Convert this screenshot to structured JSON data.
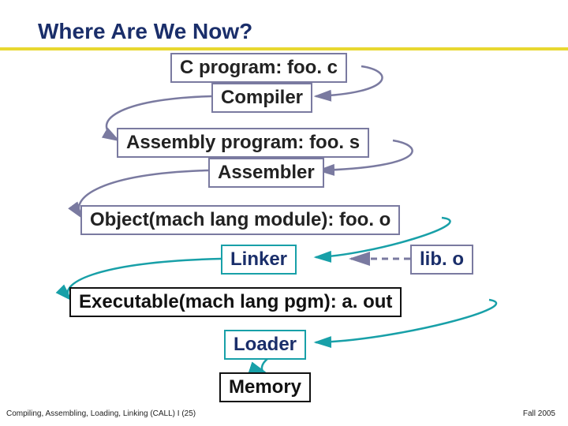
{
  "title": "Where Are We Now?",
  "stages": {
    "cprog": "C program: foo. c",
    "compiler": "Compiler",
    "asmprog": "Assembly program: foo. s",
    "assembler": "Assembler",
    "object": "Object(mach lang module): foo. o",
    "linker": "Linker",
    "lib": "lib. o",
    "exec": "Executable(mach lang pgm): a. out",
    "loader": "Loader",
    "memory": "Memory"
  },
  "footer": {
    "left": "Compiling, Assembling, Loading, Linking (CALL) I (25)",
    "right": "Fall 2005"
  },
  "flow": [
    [
      "cprog",
      "compiler"
    ],
    [
      "compiler",
      "asmprog"
    ],
    [
      "asmprog",
      "assembler"
    ],
    [
      "assembler",
      "object"
    ],
    [
      "object",
      "linker"
    ],
    [
      "lib",
      "linker"
    ],
    [
      "linker",
      "exec"
    ],
    [
      "exec",
      "loader"
    ],
    [
      "loader",
      "memory"
    ]
  ]
}
